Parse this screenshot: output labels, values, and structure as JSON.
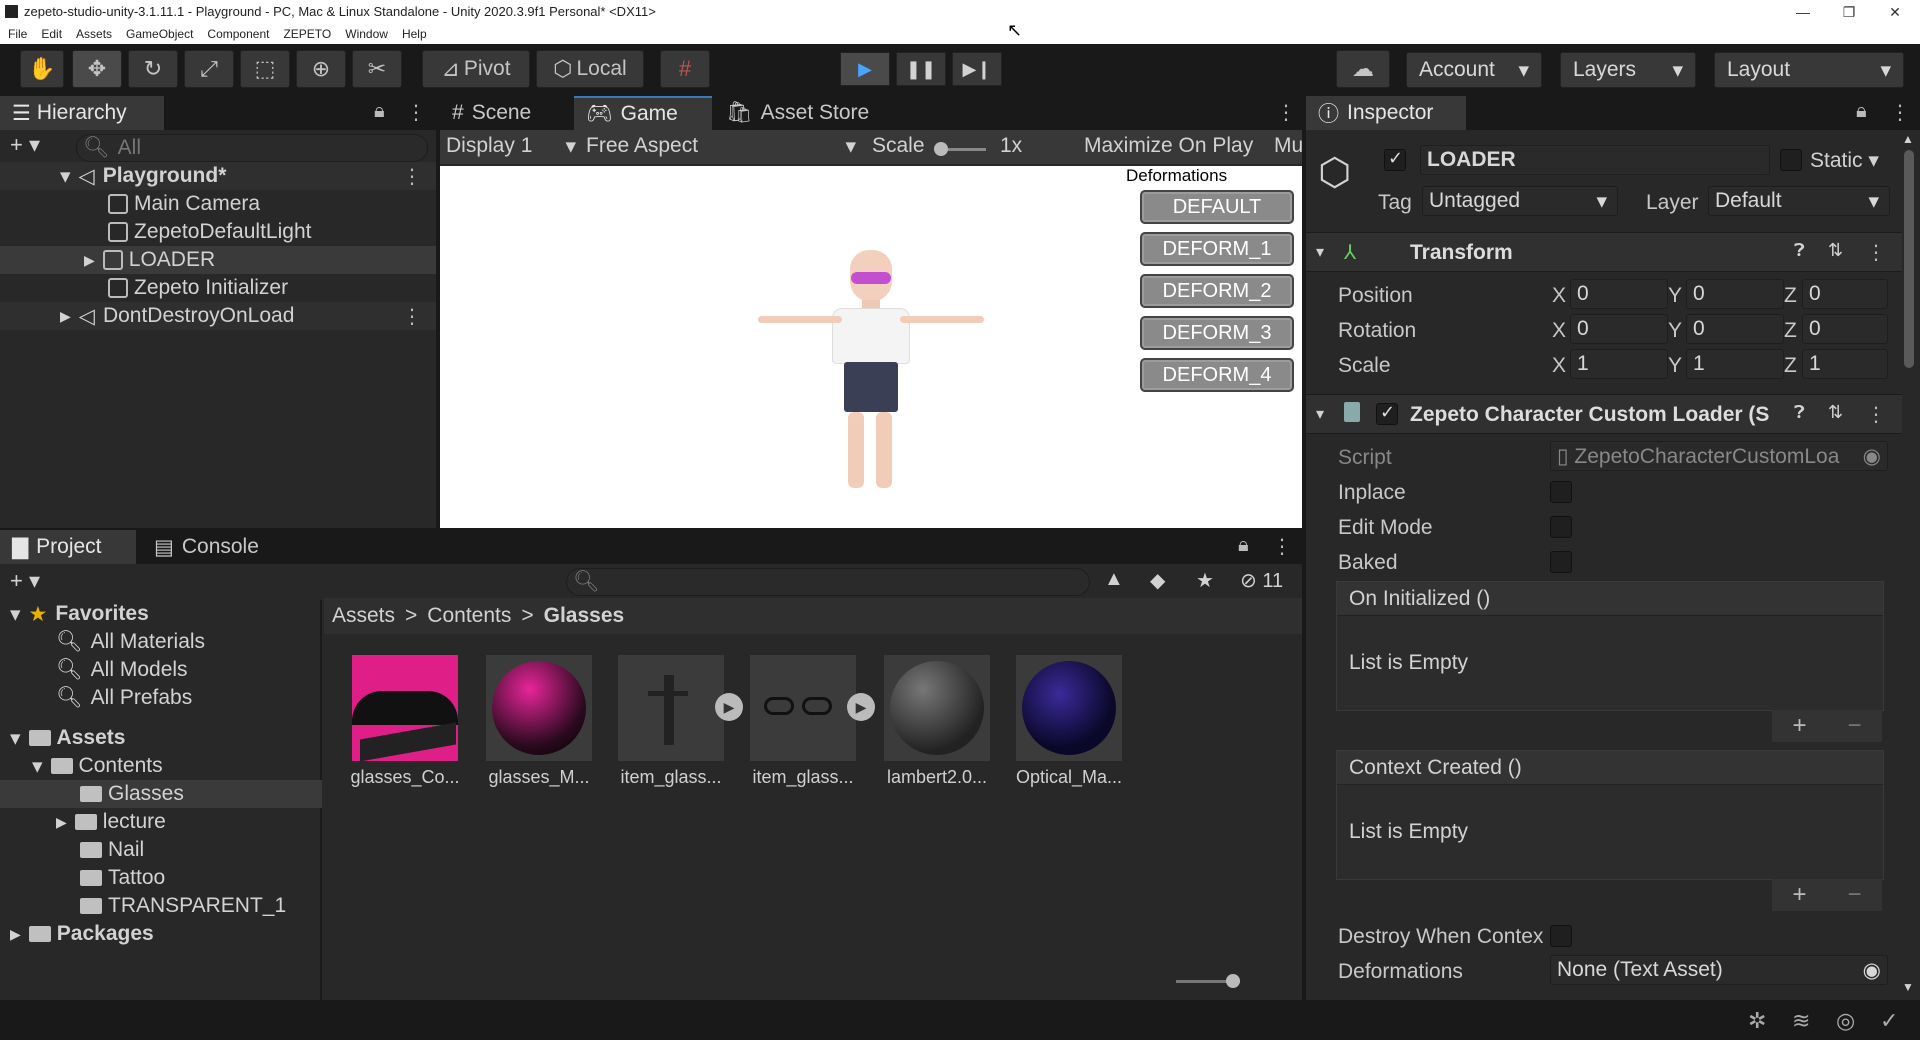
{
  "window": {
    "title": "zepeto-studio-unity-3.1.11.1 - Playground - PC, Mac & Linux Standalone - Unity 2020.3.9f1 Personal* <DX11>",
    "minimize": "—",
    "restore": "❐",
    "close": "✕"
  },
  "menu": [
    "File",
    "Edit",
    "Assets",
    "GameObject",
    "Component",
    "ZEPETO",
    "Window",
    "Help"
  ],
  "toolbar": {
    "pivot": "Pivot",
    "local": "Local",
    "account": "Account",
    "layers": "Layers",
    "layout": "Layout"
  },
  "hierarchy": {
    "tab": "Hierarchy",
    "search_placeholder": "All",
    "scene": "Playground*",
    "items": [
      "Main Camera",
      "ZepetoDefaultLight",
      "LOADER",
      "Zepeto Initializer"
    ],
    "dontdestroy": "DontDestroyOnLoad"
  },
  "view": {
    "tabs": [
      "Scene",
      "Game",
      "Asset Store"
    ],
    "display": "Display 1",
    "aspect": "Free Aspect",
    "scale_label": "Scale",
    "scale_value": "1x",
    "maximize": "Maximize On Play",
    "mute": "Mu"
  },
  "game": {
    "deformations_title": "Deformations",
    "buttons": [
      "DEFAULT",
      "DEFORM_1",
      "DEFORM_2",
      "DEFORM_3",
      "DEFORM_4"
    ]
  },
  "project": {
    "tabs": [
      "Project",
      "Console"
    ],
    "hidden_count": "11",
    "favorites": "Favorites",
    "fav_items": [
      "All Materials",
      "All Models",
      "All Prefabs"
    ],
    "assets": "Assets",
    "contents": "Contents",
    "folders": [
      "Glasses",
      "lecture",
      "Nail",
      "Tattoo",
      "TRANSPARENT_1"
    ],
    "packages": "Packages",
    "breadcrumb": [
      "Assets",
      "Contents",
      "Glasses"
    ],
    "files": [
      "glasses_Co...",
      "glasses_M...",
      "item_glass...",
      "item_glass...",
      "lambert2.0...",
      "Optical_Ma..."
    ]
  },
  "inspector": {
    "tab": "Inspector",
    "object_name": "LOADER",
    "static": "Static",
    "tag_label": "Tag",
    "tag": "Untagged",
    "layer_label": "Layer",
    "layer": "Default",
    "transform": {
      "title": "Transform",
      "rows": [
        {
          "label": "Position",
          "x": "0",
          "y": "0",
          "z": "0"
        },
        {
          "label": "Rotation",
          "x": "0",
          "y": "0",
          "z": "0"
        },
        {
          "label": "Scale",
          "x": "1",
          "y": "1",
          "z": "1"
        }
      ],
      "axes": [
        "X",
        "Y",
        "Z"
      ]
    },
    "component": {
      "title": "Zepeto Character Custom Loader (S",
      "script_label": "Script",
      "script": "ZepetoCharacterCustomLoa",
      "inplace": "Inplace",
      "editmode": "Edit Mode",
      "baked": "Baked",
      "on_init": "On Initialized ()",
      "context": "Context Created ()",
      "empty": "List is Empty",
      "destroy": "Destroy When Contex",
      "deform_label": "Deformations",
      "deform_value": "None (Text Asset)"
    }
  }
}
